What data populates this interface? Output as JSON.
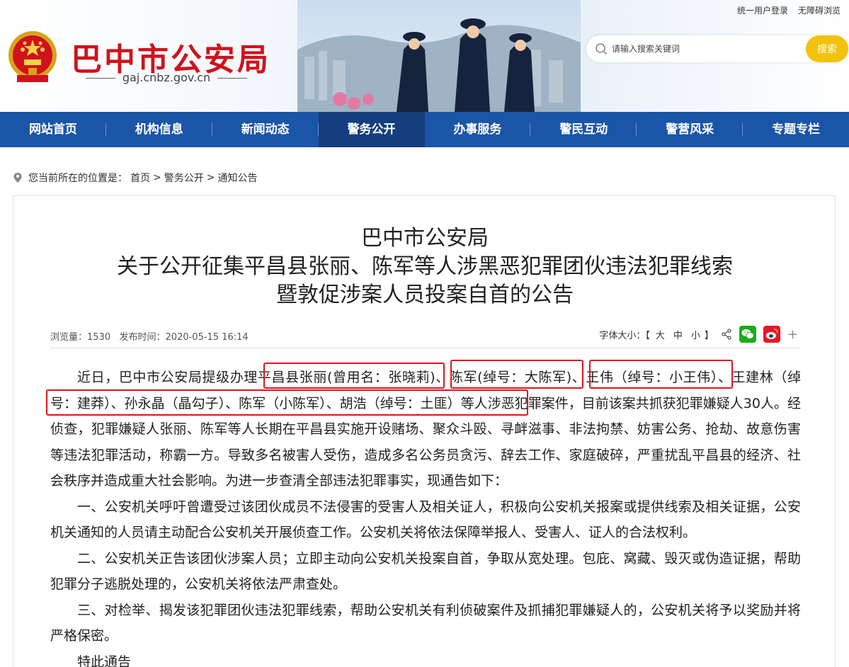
{
  "top_links": {
    "login": "统一用户登录",
    "accessible": "无障碍浏览"
  },
  "site": {
    "name": "巴中市公安局",
    "domain": "gaj.cnbz.gov.cn"
  },
  "search": {
    "placeholder": "请输入搜索关键词",
    "button": "搜索"
  },
  "nav": [
    {
      "label": "网站首页"
    },
    {
      "label": "机构信息"
    },
    {
      "label": "新闻动态"
    },
    {
      "label": "警务公开",
      "active": true
    },
    {
      "label": "办事服务"
    },
    {
      "label": "警民互动"
    },
    {
      "label": "警营风采"
    },
    {
      "label": "专题专栏"
    }
  ],
  "breadcrumb": {
    "prefix": "您当前所在的位置是：",
    "items": [
      "首页",
      "警务公开",
      "通知公告"
    ],
    "sep": ">"
  },
  "article": {
    "title_lines": [
      "巴中市公安局",
      "关于公开征集平昌县张丽、陈军等人涉黑恶犯罪团伙违法犯罪线索",
      "暨敦促涉案人员投案自首的公告"
    ],
    "views_label": "浏览量：",
    "views": "1530",
    "date_label": "发布时间：",
    "date": "2020-05-15 16:14",
    "font_size_label": "字体大小：【",
    "font_sizes": [
      "大",
      "中",
      "小"
    ],
    "font_size_close": "】",
    "paragraphs": [
      "近日，巴中市公安局提级办理平昌县张丽(曾用名：张晓莉)、陈军(绰号：大陈军)、王伟（绰号：小王伟）、王建林（绰号：建莽）、孙永晶（晶勾子）、陈军（小陈军）、胡浩（绰号：土匪）等人涉恶犯罪案件，目前该案共抓获犯罪嫌疑人30人。经侦查，犯罪嫌疑人张丽、陈军等人长期在平昌县实施开设赌场、聚众斗殴、寻衅滋事、非法拘禁、妨害公务、抢劫、故意伤害等违法犯罪活动，称霸一方。导致多名被害人受伤，造成多名公务员贪污、辞去工作、家庭破碎，严重扰乱平昌县的经济、社会秩序并造成重大社会影响。为进一步查清全部违法犯罪事实，现通告如下：",
      "一、公安机关呼吁曾遭受过该团伙成员不法侵害的受害人及相关证人，积极向公安机关报案或提供线索及相关证据，公安机关通知的人员请主动配合公安机关开展侦查工作。公安机关将依法保障举报人、受害人、证人的合法权利。",
      "二、公安机关正告该团伙涉案人员；立即主动向公安机关投案自首，争取从宽处理。包庇、窝藏、毁灭或伪造证据，帮助犯罪分子逃脱处理的，公安机关将依法严肃查处。",
      "三、对检举、揭发该犯罪团伙违法犯罪线索，帮助公安机关有利侦破案件及抓捕犯罪嫌疑人的，公安机关将予以奖励并将严格保密。",
      "特此通告"
    ]
  },
  "colors": {
    "brand_red": "#d0121b",
    "nav_blue": "#1b55a8",
    "nav_active": "#143f7e",
    "search_btn": "#f2c20c",
    "highlight": "#e0141e"
  },
  "icons": [
    "national-emblem-icon",
    "search-icon",
    "location-pin-icon",
    "share-icon",
    "wechat-icon",
    "weibo-icon",
    "plus-icon"
  ]
}
